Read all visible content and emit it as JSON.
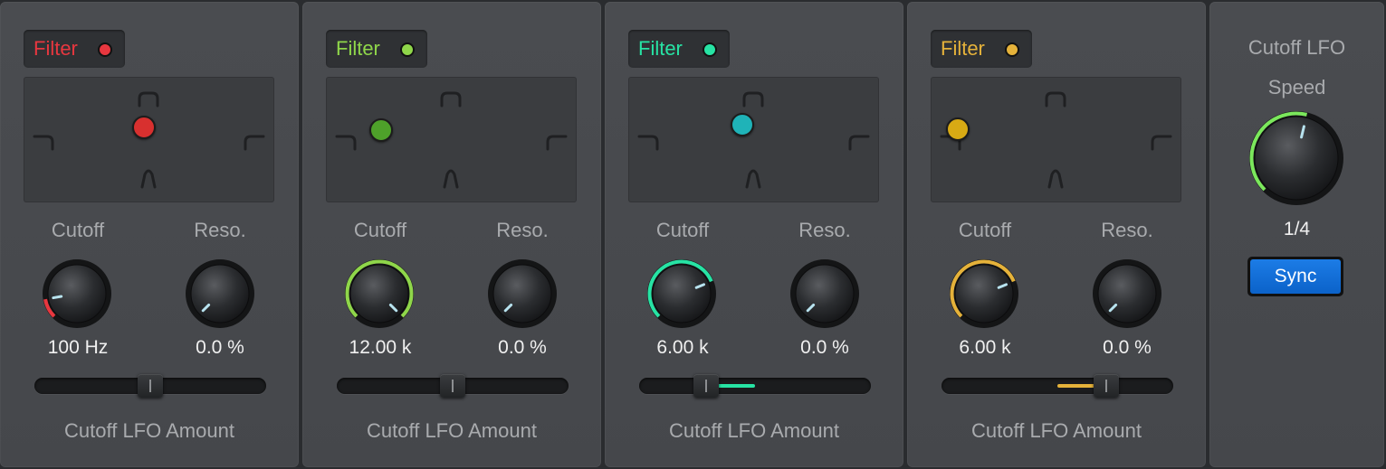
{
  "filters": [
    {
      "label": "Filter",
      "accent": "#e8373f",
      "dot_color": "#d8302f",
      "cutoff_label": "Cutoff",
      "reso_label": "Reso.",
      "cutoff_value": "100 Hz",
      "reso_value": "0.0 %",
      "cutoff_level": 0.13,
      "reso_level": 0.0,
      "lfo_amount": 0.0,
      "lfo_amount_label": "Cutoff LFO Amount"
    },
    {
      "label": "Filter",
      "accent": "#8fd64a",
      "dot_color": "#4ea12a",
      "cutoff_label": "Cutoff",
      "reso_label": "Reso.",
      "cutoff_value": "12.00 k",
      "reso_value": "0.0 %",
      "cutoff_level": 1.0,
      "reso_level": 0.0,
      "lfo_amount": 0.0,
      "lfo_amount_label": "Cutoff LFO Amount"
    },
    {
      "label": "Filter",
      "accent": "#27e3a4",
      "dot_color": "#1fb3b8",
      "cutoff_label": "Cutoff",
      "reso_label": "Reso.",
      "cutoff_value": "6.00 k",
      "reso_value": "0.0 %",
      "cutoff_level": 0.75,
      "reso_level": 0.0,
      "lfo_amount": -0.5,
      "lfo_amount_label": "Cutoff LFO Amount"
    },
    {
      "label": "Filter",
      "accent": "#e5b23a",
      "dot_color": "#d8aa14",
      "cutoff_label": "Cutoff",
      "reso_label": "Reso.",
      "cutoff_value": "6.00 k",
      "reso_value": "0.0 %",
      "cutoff_level": 0.75,
      "reso_level": 0.0,
      "lfo_amount": 0.5,
      "lfo_amount_label": "Cutoff LFO Amount"
    }
  ],
  "lfo": {
    "title": "Cutoff LFO",
    "speed_label": "Speed",
    "speed_value": "1/4",
    "speed_level": 0.55,
    "accent": "#7be85c",
    "sync_label": "Sync"
  },
  "icons": [
    "lowpass-shape-icon",
    "highpass-shape-icon",
    "bandpass-shape-icon",
    "notch-shape-icon"
  ]
}
